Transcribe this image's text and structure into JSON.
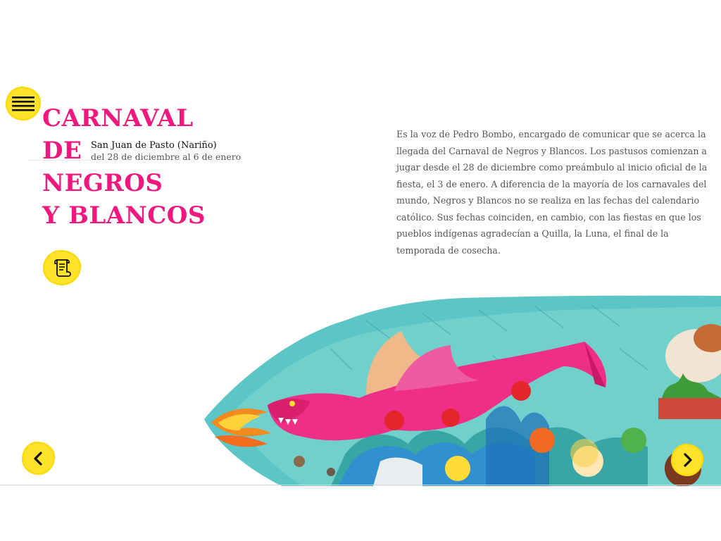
{
  "title": {
    "line1": "CARNAVAL",
    "line2": "DE",
    "line3": "NEGROS",
    "line4": "Y BLANCOS"
  },
  "subtitle": {
    "place": "San Juan de Pasto (Nariño)",
    "dates": "del 28 de diciembre al 6 de enero"
  },
  "body": "Es la voz de Pedro Bombo, encargado de comunicar que se acerca la llegada del Carnaval de Negros y Blancos. Los pastusos comienzan a jugar desde el 28 de diciembre como preámbulo al inicio oficial de la fiesta, el 3 de enero. A diferencia de la mayoría de los carnavales del mundo, Negros y Blancos no se realiza en las fechas del calendario católico. Sus fechas coinciden, en cambio, con las fiestas en que los pueblos indígenas agradecían a Quilla, la Luna, el final de la temporada de cosecha.",
  "icons": {
    "menu": "hamburger-menu-icon",
    "document": "scroll-document-icon",
    "previous": "chevron-left-icon",
    "next": "chevron-right-icon",
    "illustration": "dragon-carnival-illustration"
  },
  "colors": {
    "title": "#f0187f",
    "button": "#ffe22a",
    "text": "#555555"
  }
}
